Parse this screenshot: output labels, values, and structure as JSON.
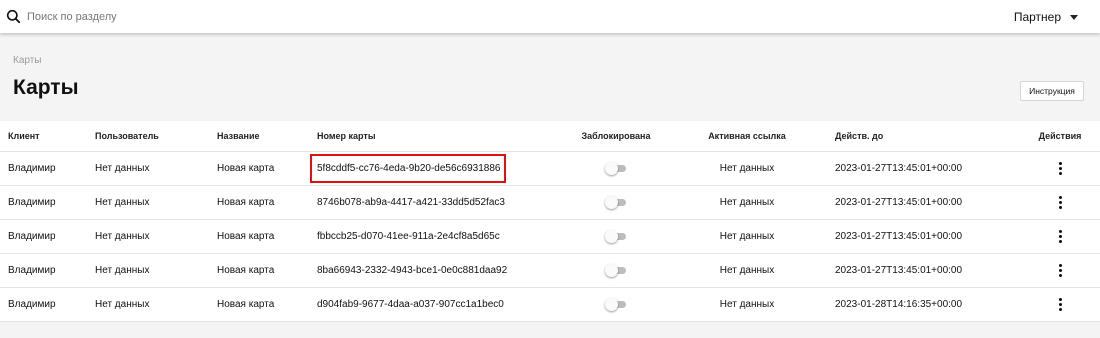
{
  "topbar": {
    "search_placeholder": "Поиск по разделу",
    "partner_label": "Партнер"
  },
  "breadcrumb": "Карты",
  "page_title": "Карты",
  "help_button": "Инструкция",
  "table": {
    "headers": {
      "client": "Клиент",
      "user": "Пользователь",
      "name": "Название",
      "card": "Номер карты",
      "blocked": "Заблокирована",
      "link": "Активная ссылка",
      "valid": "Действ. до",
      "actions": "Действия"
    },
    "rows": [
      {
        "client": "Владимир",
        "user": "Нет данных",
        "name": "Новая карта",
        "card": "5f8cddf5-cc76-4eda-9b20-de56c6931886",
        "blocked": false,
        "link": "Нет данных",
        "valid": "2023-01-27T13:45:01+00:00"
      },
      {
        "client": "Владимир",
        "user": "Нет данных",
        "name": "Новая карта",
        "card": "8746b078-ab9a-4417-a421-33dd5d52fac3",
        "blocked": false,
        "link": "Нет данных",
        "valid": "2023-01-27T13:45:01+00:00"
      },
      {
        "client": "Владимир",
        "user": "Нет данных",
        "name": "Новая карта",
        "card": "fbbccb25-d070-41ee-911a-2e4cf8a5d65c",
        "blocked": false,
        "link": "Нет данных",
        "valid": "2023-01-27T13:45:01+00:00"
      },
      {
        "client": "Владимир",
        "user": "Нет данных",
        "name": "Новая карта",
        "card": "8ba66943-2332-4943-bce1-0e0c881daa92",
        "blocked": false,
        "link": "Нет данных",
        "valid": "2023-01-27T13:45:01+00:00"
      },
      {
        "client": "Владимир",
        "user": "Нет данных",
        "name": "Новая карта",
        "card": "d904fab9-9677-4daa-a037-907cc1a1bec0",
        "blocked": false,
        "link": "Нет данных",
        "valid": "2023-01-28T14:16:35+00:00"
      }
    ]
  },
  "highlight_color": "#e01010"
}
